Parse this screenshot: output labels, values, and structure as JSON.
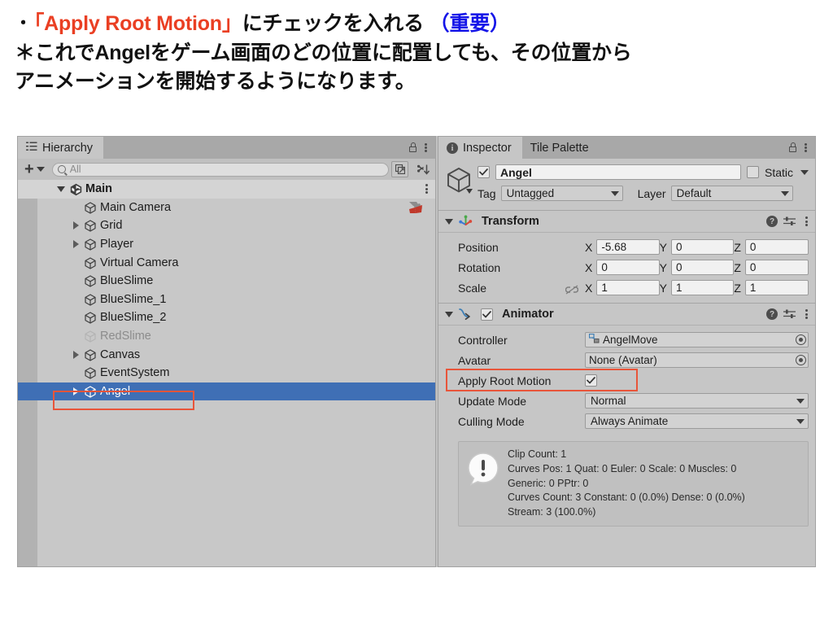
{
  "slide": {
    "line1_bullet": "・",
    "line1_quoted": "「Apply Root Motion」",
    "line1_mid": "にチェックを入れる",
    "line1_note": "（重要）",
    "line2": "＊これでAngelをゲーム画面のどの位置に配置しても、その位置から",
    "line3": "アニメーションを開始するようになります。",
    "accent_red": "#ea3f23",
    "accent_blue": "#1515e8"
  },
  "hierarchy": {
    "tab_label": "Hierarchy",
    "toolbar": {
      "add_label": "+",
      "search_placeholder": "All",
      "search_value": ""
    },
    "rows": [
      {
        "label": "Main",
        "indent": 0,
        "expanded": true,
        "arrow": "open",
        "state": "root"
      },
      {
        "label": "Main Camera",
        "indent": 1,
        "expanded": false,
        "arrow": "none",
        "state": "normal"
      },
      {
        "label": "Grid",
        "indent": 1,
        "expanded": false,
        "arrow": "closed",
        "state": "normal"
      },
      {
        "label": "Player",
        "indent": 1,
        "expanded": false,
        "arrow": "closed",
        "state": "normal"
      },
      {
        "label": "Virtual Camera",
        "indent": 1,
        "expanded": false,
        "arrow": "none",
        "state": "normal"
      },
      {
        "label": "BlueSlime",
        "indent": 1,
        "expanded": false,
        "arrow": "none",
        "state": "normal"
      },
      {
        "label": "BlueSlime_1",
        "indent": 1,
        "expanded": false,
        "arrow": "none",
        "state": "normal"
      },
      {
        "label": "BlueSlime_2",
        "indent": 1,
        "expanded": false,
        "arrow": "none",
        "state": "normal"
      },
      {
        "label": "RedSlime",
        "indent": 1,
        "expanded": false,
        "arrow": "none",
        "state": "disabled"
      },
      {
        "label": "Canvas",
        "indent": 1,
        "expanded": false,
        "arrow": "closed",
        "state": "normal"
      },
      {
        "label": "EventSystem",
        "indent": 1,
        "expanded": false,
        "arrow": "none",
        "state": "normal"
      },
      {
        "label": "Angel",
        "indent": 1,
        "expanded": false,
        "arrow": "closed",
        "state": "selected"
      }
    ],
    "selection_color": "#3f6fb5",
    "highlight_color": "#e8553a"
  },
  "inspector": {
    "tabs": [
      {
        "label": "Inspector",
        "active": true
      },
      {
        "label": "Tile Palette",
        "active": false
      }
    ],
    "gameobject": {
      "enabled": true,
      "name": "Angel",
      "static_label": "Static",
      "static_checked": false,
      "tag_label": "Tag",
      "tag_value": "Untagged",
      "layer_label": "Layer",
      "layer_value": "Default"
    },
    "transform": {
      "title": "Transform",
      "expanded": true,
      "rows": [
        {
          "label": "Position",
          "x": "-5.68",
          "y": "0",
          "z": "0",
          "link": false
        },
        {
          "label": "Rotation",
          "x": "0",
          "y": "0",
          "z": "0",
          "link": false
        },
        {
          "label": "Scale",
          "x": "1",
          "y": "1",
          "z": "1",
          "link": true
        }
      ],
      "axis_labels": [
        "X",
        "Y",
        "Z"
      ]
    },
    "animator": {
      "title": "Animator",
      "expanded": true,
      "enabled": true,
      "controller_label": "Controller",
      "controller_value": "AngelMove",
      "avatar_label": "Avatar",
      "avatar_value": "None (Avatar)",
      "apply_root_motion_label": "Apply Root Motion",
      "apply_root_motion_checked": true,
      "update_mode_label": "Update Mode",
      "update_mode_value": "Normal",
      "culling_mode_label": "Culling Mode",
      "culling_mode_value": "Always Animate",
      "info": [
        "Clip Count: 1",
        "Curves Pos: 1 Quat: 0 Euler: 0 Scale: 0 Muscles: 0",
        "Generic: 0 PPtr: 0",
        "Curves Count: 3 Constant: 0 (0.0%) Dense: 0 (0.0%)",
        "Stream: 3 (100.0%)"
      ]
    }
  }
}
